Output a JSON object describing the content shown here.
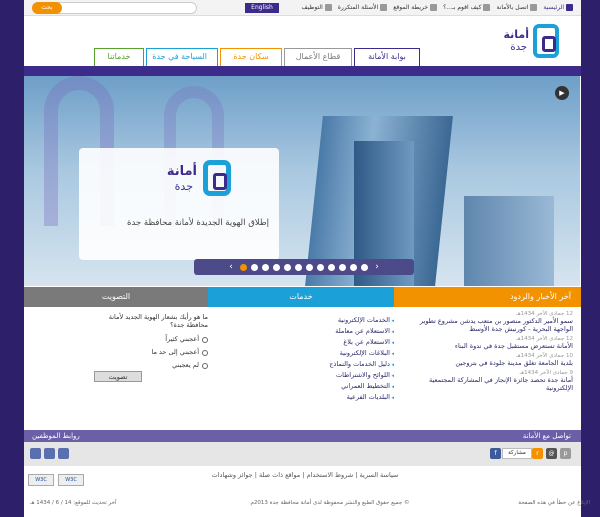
{
  "topbar": {
    "home": "الرئيسية",
    "contact": "اتصل بالأمانة",
    "howto": "كيف اقوم بـ...؟",
    "sitemap": "خريطة الموقع",
    "faq": "الأسئلة المتكررة",
    "jobs": "التوظيف",
    "english": "English",
    "search_label": "بحث",
    "search_value": ""
  },
  "header": {
    "logo_line1": "أمانة",
    "logo_line2": "جدة"
  },
  "nav": {
    "portal": "بوابة الأمانة",
    "business": "قطاع الأعمال",
    "residents": "سكان جدة",
    "tourism": "السياحة في جدة",
    "services": "خدماتنا"
  },
  "banner": {
    "card_line1": "أمانة",
    "card_line2": "جدة",
    "caption": "إطلاق الهوية الجديدة لأمانة محافظة جدة",
    "slide_count": 12,
    "active_slide": 1
  },
  "news": {
    "heading": "آخر الأخبار والردود",
    "items": [
      {
        "date": "12 جمادى الآخر 1434هـ",
        "title": "سمو الأمير الدكتور منصور بن متعب يدشن مشروع تطوير الواجهة البحرية - كورنيش جدة الأوسط"
      },
      {
        "date": "12 جمادى الآخر 1434هـ",
        "title": "الأمانة تستعرض مستقبل جدة في ندوة البناء"
      },
      {
        "date": "10 جمادى الآخر 1434هـ",
        "title": "بلدية الجامعة تغلق مدينة جلودة في بتروجين"
      },
      {
        "date": "9 جمادى الآخر 1434هـ",
        "title": "أمانة جدة تحصد جائزة الإنجاز في المشاركة المجتمعية الإلكترونية"
      }
    ]
  },
  "services": {
    "heading": "خدمات",
    "items": [
      "الخدمات الإلكترونية",
      "الاستعلام عن معاملة",
      "الاستعلام عن بلاغ",
      "البلاغات الإلكترونية",
      "دليل الخدمات والنماذج",
      "اللوائح والاشتراطات",
      "التخطيط العمراني",
      "البلديات الفرعية"
    ]
  },
  "poll": {
    "heading": "التصويت",
    "question": "ما هو رأيك بشعار الهوية الجديد لأمانة محافظة جدة؟",
    "options": [
      "أعجبني كثيراً",
      "أعجبني إلى حد ما",
      "لم يعجبني"
    ],
    "vote_label": "تصويت"
  },
  "social": {
    "heading_right": "تواصل مع الأمانة",
    "heading_left": "روابط الموظفين",
    "share_label": "مشاركة"
  },
  "footer": {
    "links": "سياسة السرية | شروط الاستخدام | مواقع ذات صلة | جوائز وشهادات",
    "copyright": "© جميع حقوق الطبع والنشر محفوظة لدى أمانة محافظة جدة 2013م",
    "report": "الإبلاغ عن خطأ في هذه الصفحة",
    "updated": "آخر تحديث للموقع: 14 / 6 / 1434 هـ",
    "badge1": "W3C",
    "badge2": "W3C"
  }
}
